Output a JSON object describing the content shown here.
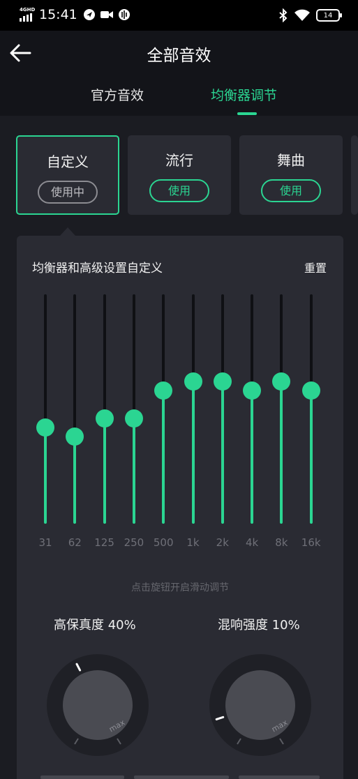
{
  "status_bar": {
    "network": "4GHD",
    "time": "15:41",
    "battery": "14",
    "left_icons": [
      "navigation-icon",
      "video-icon",
      "sound-icon"
    ],
    "right_icons": [
      "bluetooth-icon",
      "wifi-icon"
    ]
  },
  "header": {
    "title": "全部音效",
    "tabs": [
      {
        "label": "官方音效",
        "active": false
      },
      {
        "label": "均衡器调节",
        "active": true
      }
    ]
  },
  "presets": [
    {
      "name": "自定义",
      "button": "使用中",
      "active": true
    },
    {
      "name": "流行",
      "button": "使用",
      "active": false
    },
    {
      "name": "舞曲",
      "button": "使用",
      "active": false
    }
  ],
  "equalizer": {
    "heading": "均衡器和高级设置自定义",
    "reset_label": "重置",
    "bands": [
      {
        "label": "31",
        "level": 0.42
      },
      {
        "label": "62",
        "level": 0.38
      },
      {
        "label": "125",
        "level": 0.46
      },
      {
        "label": "250",
        "level": 0.46
      },
      {
        "label": "500",
        "level": 0.58
      },
      {
        "label": "1k",
        "level": 0.62
      },
      {
        "label": "2k",
        "level": 0.62
      },
      {
        "label": "4k",
        "level": 0.58
      },
      {
        "label": "8k",
        "level": 0.62
      },
      {
        "label": "16k",
        "level": 0.58
      }
    ],
    "hint": "点击旋钮开启滑动调节"
  },
  "knobs": [
    {
      "label": "高保真度 40%",
      "value": 0.4,
      "max_label": "max"
    },
    {
      "label": "混响强度 10%",
      "value": 0.1,
      "max_label": "max"
    }
  ],
  "colors": {
    "accent": "#2bd592",
    "background": "#1b1c22",
    "panel": "#2a2b33"
  }
}
